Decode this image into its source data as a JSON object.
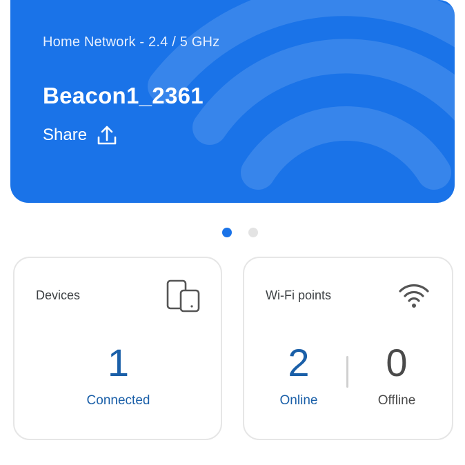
{
  "network": {
    "band": "Home Network - 2.4 / 5 GHz",
    "name": "Beacon1_2361",
    "share_label": "Share"
  },
  "pager": {
    "count": 2,
    "active": 0
  },
  "devices": {
    "title": "Devices",
    "connected_count": "1",
    "connected_label": "Connected"
  },
  "wifi_points": {
    "title": "Wi-Fi points",
    "online_count": "2",
    "online_label": "Online",
    "offline_count": "0",
    "offline_label": "Offline"
  },
  "colors": {
    "accent": "#1a73e8",
    "stat_blue": "#1a5fa8",
    "stat_grey": "#4a4a4a"
  },
  "icons": {
    "share": "share-icon",
    "devices": "devices-icon",
    "wifi": "wifi-icon"
  }
}
